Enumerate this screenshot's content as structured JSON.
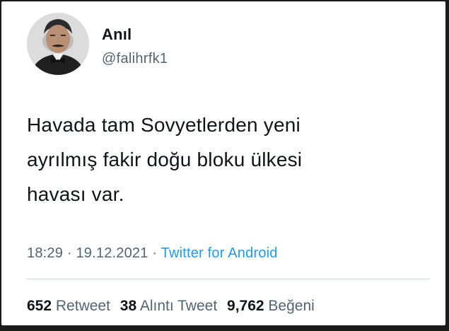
{
  "user": {
    "display_name": "Anıl",
    "handle": "@falihrfk1"
  },
  "tweet": {
    "lines": [
      "Havada tam Sovyetlerden yeni",
      "ayrılmış fakir doğu bloku ülkesi",
      "havası var."
    ],
    "time": "18:29",
    "separator": "·",
    "date": "19.12.2021",
    "source": "Twitter for Android"
  },
  "stats": {
    "retweets": {
      "count": "652",
      "label": "Retweet"
    },
    "quotes": {
      "count": "38",
      "label": "Alıntı Tweet"
    },
    "likes": {
      "count": "9,762",
      "label": "Beğeni"
    }
  },
  "colors": {
    "text": "#0f1419",
    "secondary": "#536471",
    "link": "#1d9bf0"
  }
}
